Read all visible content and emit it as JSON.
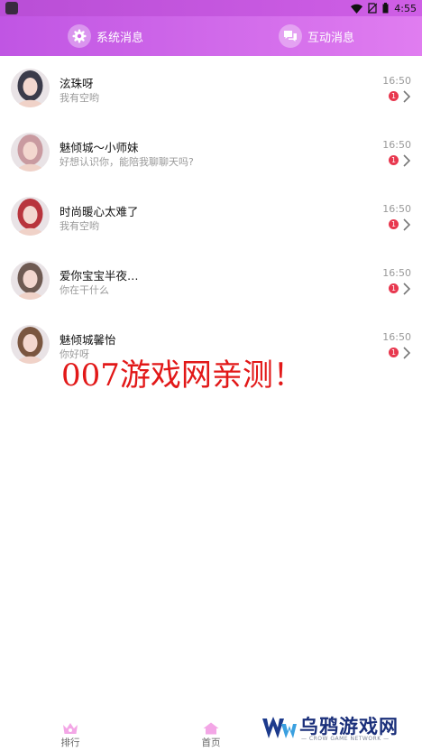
{
  "status_bar": {
    "time": "4:55"
  },
  "tabs": [
    {
      "label": "系统消息",
      "icon": "gear-icon"
    },
    {
      "label": "互动消息",
      "icon": "chat-icon"
    }
  ],
  "messages": [
    {
      "name": "泫珠呀",
      "preview": "我有空哟",
      "time": "16:50",
      "unread": "1",
      "avatar_color": "#3b3b4a"
    },
    {
      "name": "魅倾城～小师妹",
      "preview": "好想认识你，能陪我聊聊天吗?",
      "time": "16:50",
      "unread": "1",
      "avatar_color": "#c99aa0"
    },
    {
      "name": "时尚暖心太难了",
      "preview": "我有空哟",
      "time": "16:50",
      "unread": "1",
      "avatar_color": "#b8353d"
    },
    {
      "name": "爱你宝宝半夜…",
      "preview": "你在干什么",
      "time": "16:50",
      "unread": "1",
      "avatar_color": "#6e5a52"
    },
    {
      "name": "魅倾城馨怡",
      "preview": "你好呀",
      "time": "16:50",
      "unread": "1",
      "avatar_color": "#7a5640"
    }
  ],
  "watermark": "007游戏网亲测！",
  "bottom_nav": [
    {
      "label": "排行",
      "icon": "ranking-icon"
    },
    {
      "label": "首页",
      "icon": "home-icon"
    }
  ],
  "logo": {
    "title": "乌鸦游戏网",
    "subtitle": "— CROW GAME NETWORK —"
  },
  "colors": {
    "header_start": "#c055e3",
    "header_end": "#e07df0",
    "badge": "#e8384f",
    "watermark": "#e21818"
  }
}
